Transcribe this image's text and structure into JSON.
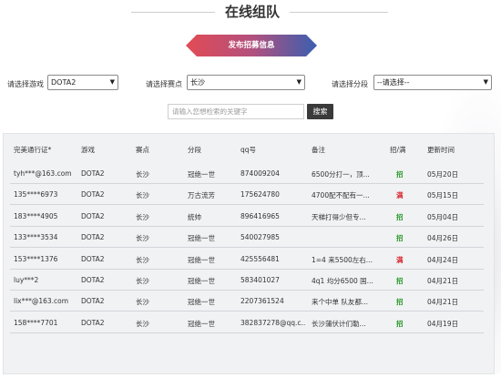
{
  "page_title": "在线组队",
  "publish_button": "发布招募信息",
  "filters": {
    "game_label": "请选择游戏",
    "game_value": "DOTA2",
    "region_label": "请选择赛点",
    "region_value": "长沙",
    "rank_label": "请选择分段",
    "rank_value": "--请选择--"
  },
  "search": {
    "placeholder": "请输入您想检索的关键字",
    "button": "搜索"
  },
  "table": {
    "headers": [
      "完美通行证*",
      "游戏",
      "赛点",
      "分段",
      "qq号",
      "备注",
      "招/满",
      "更新时间"
    ],
    "rows": [
      {
        "account": "tyh***@163.com",
        "game": "DOTA2",
        "region": "长沙",
        "rank": "冠绝一世",
        "qq": "874009204",
        "note": "6500分打一，顶...",
        "status": "招",
        "date": "05月20日"
      },
      {
        "account": "135****6973",
        "game": "DOTA2",
        "region": "长沙",
        "rank": "万古流芳",
        "qq": "175624780",
        "note": "4700配不配有一...",
        "status": "满",
        "date": "05月15日"
      },
      {
        "account": "183****4905",
        "game": "DOTA2",
        "region": "长沙",
        "rank": "统帅",
        "qq": "896416965",
        "note": "天梯打得少但专...",
        "status": "招",
        "date": "05月04日"
      },
      {
        "account": "133****3534",
        "game": "DOTA2",
        "region": "长沙",
        "rank": "冠绝一世",
        "qq": "540027985",
        "note": "",
        "status": "招",
        "date": "04月26日"
      },
      {
        "account": "153****1376",
        "game": "DOTA2",
        "region": "长沙",
        "rank": "冠绝一世",
        "qq": "425556481",
        "note": "1=4 来5500左右...",
        "status": "满",
        "date": "04月24日"
      },
      {
        "account": "luy***2",
        "game": "DOTA2",
        "region": "长沙",
        "rank": "冠绝一世",
        "qq": "583401027",
        "note": "4q1 均分6500 国...",
        "status": "招",
        "date": "04月21日"
      },
      {
        "account": "lix***@163.com",
        "game": "DOTA2",
        "region": "长沙",
        "rank": "冠绝一世",
        "qq": "2207361524",
        "note": "来个中单 队友都...",
        "status": "招",
        "date": "04月21日"
      },
      {
        "account": "158****7701",
        "game": "DOTA2",
        "region": "长沙",
        "rank": "冠绝一世",
        "qq": "382837278@qq.c...",
        "note": "长沙蒲伏计们勒...",
        "status": "招",
        "date": "04月19日"
      }
    ]
  },
  "colors": {
    "recruit": "#2a9a2a",
    "full": "#d8252b",
    "search_button": "#3a3a3a"
  }
}
